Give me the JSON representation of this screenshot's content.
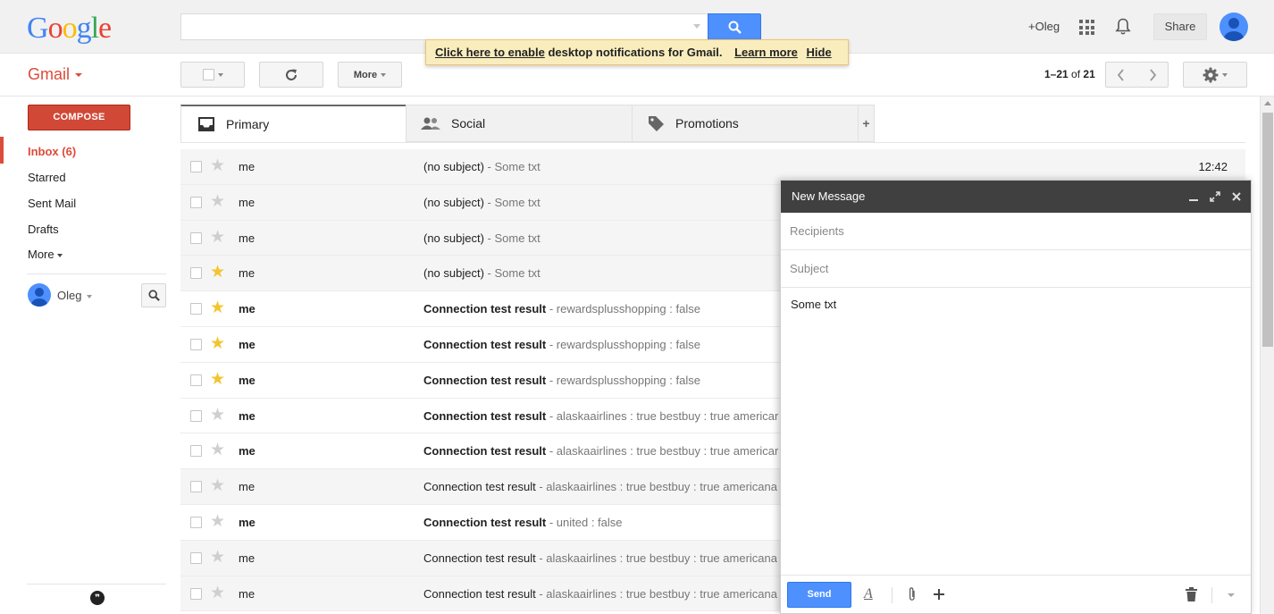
{
  "logo": {
    "letters": [
      "G",
      "o",
      "o",
      "g",
      "l",
      "e"
    ],
    "colors": [
      "#4285f4",
      "#ea4335",
      "#fbbc05",
      "#4285f4",
      "#34a853",
      "#ea4335"
    ]
  },
  "search": {
    "value": "",
    "placeholder": ""
  },
  "topbar": {
    "user": "+Oleg",
    "share": "Share"
  },
  "notification": {
    "enable_link": "Click here to enable",
    "message": " desktop notifications for Gmail.",
    "learn_more": "Learn more",
    "hide": "Hide"
  },
  "app_label": "Gmail",
  "toolbar": {
    "more": "More"
  },
  "pager": {
    "range": "1–21",
    "of": "of",
    "total": "21"
  },
  "sidebar": {
    "compose": "COMPOSE",
    "items": [
      {
        "label": "Inbox (6)"
      },
      {
        "label": "Starred"
      },
      {
        "label": "Sent Mail"
      },
      {
        "label": "Drafts"
      },
      {
        "label": "More"
      }
    ],
    "user": "Oleg"
  },
  "tabs": [
    {
      "label": "Primary",
      "icon": "inbox-icon"
    },
    {
      "label": "Social",
      "icon": "people-icon"
    },
    {
      "label": "Promotions",
      "icon": "tag-icon"
    }
  ],
  "emails": [
    {
      "from": "me",
      "subject": "(no subject)",
      "snippet": " - Some txt",
      "time": "12:42",
      "starred": false,
      "unread": false
    },
    {
      "from": "me",
      "subject": "(no subject)",
      "snippet": " - Some txt",
      "time": "",
      "starred": false,
      "unread": false
    },
    {
      "from": "me",
      "subject": "(no subject)",
      "snippet": " - Some txt",
      "time": "",
      "starred": false,
      "unread": false
    },
    {
      "from": "me",
      "subject": "(no subject)",
      "snippet": " - Some txt",
      "time": "",
      "starred": true,
      "unread": false
    },
    {
      "from": "me",
      "subject": "Connection test result",
      "snippet": " - rewardsplusshopping : false",
      "time": "",
      "starred": true,
      "unread": true
    },
    {
      "from": "me",
      "subject": "Connection test result",
      "snippet": " - rewardsplusshopping : false",
      "time": "",
      "starred": true,
      "unread": true
    },
    {
      "from": "me",
      "subject": "Connection test result",
      "snippet": " - rewardsplusshopping : false",
      "time": "",
      "starred": true,
      "unread": true
    },
    {
      "from": "me",
      "subject": "Connection test result",
      "snippet": " - alaskaairlines : true bestbuy : true americar",
      "time": "",
      "starred": false,
      "unread": true
    },
    {
      "from": "me",
      "subject": "Connection test result",
      "snippet": " - alaskaairlines : true bestbuy : true americar",
      "time": "",
      "starred": false,
      "unread": true
    },
    {
      "from": "me",
      "subject": "Connection test result",
      "snippet": " - alaskaairlines : true bestbuy : true americana",
      "time": "",
      "starred": false,
      "unread": false
    },
    {
      "from": "me",
      "subject": "Connection test result",
      "snippet": " - united : false",
      "time": "",
      "starred": false,
      "unread": true
    },
    {
      "from": "me",
      "subject": "Connection test result",
      "snippet": " - alaskaairlines : true bestbuy : true americana",
      "time": "",
      "starred": false,
      "unread": false
    },
    {
      "from": "me",
      "subject": "Connection test result",
      "snippet": " - alaskaairlines : true bestbuy : true americana",
      "time": "",
      "starred": false,
      "unread": false
    }
  ],
  "compose_window": {
    "title": "New Message",
    "recipients_placeholder": "Recipients",
    "subject_placeholder": "Subject",
    "body": "Some txt",
    "send": "Send"
  },
  "colors": {
    "accent_red": "#dd4b39",
    "blue": "#4d90fe",
    "star": "#f4c430"
  }
}
